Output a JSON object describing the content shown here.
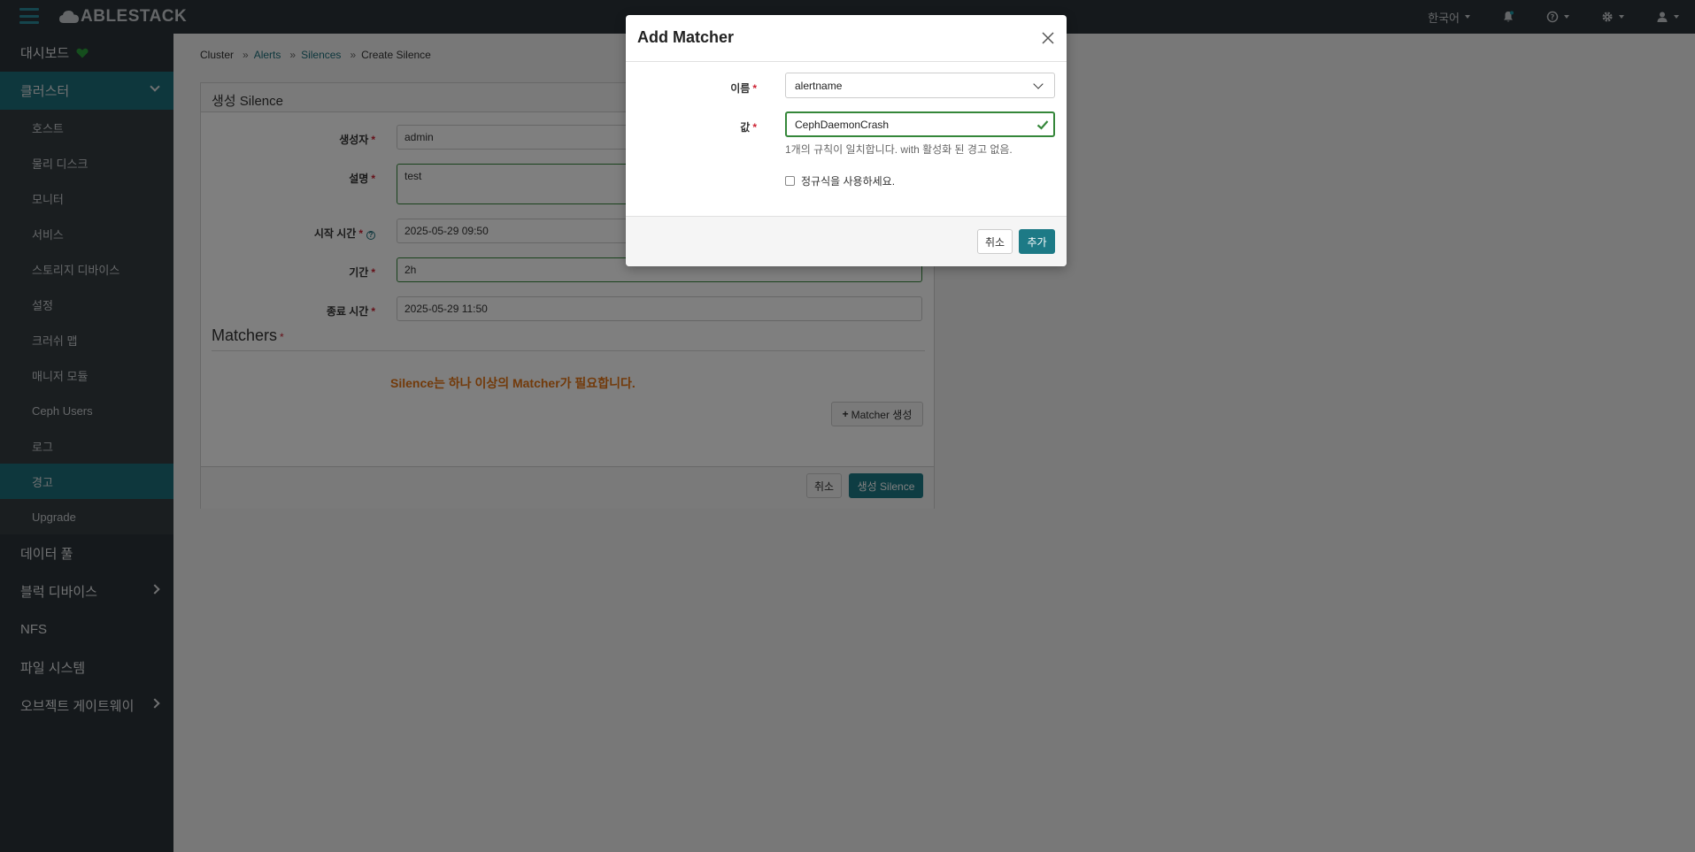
{
  "navbar": {
    "brand": "ABLESTACK",
    "language": "한국어"
  },
  "sidebar": {
    "dashboard": "대시보드",
    "cluster": "클러스터",
    "cluster_items": [
      "호스트",
      "물리 디스크",
      "모니터",
      "서비스",
      "스토리지 디바이스",
      "설정",
      "크러쉬 맵",
      "매니저 모듈",
      "Ceph Users",
      "로그",
      "경고",
      "Upgrade"
    ],
    "pools": "데이터 풀",
    "block": "블럭 디바이스",
    "nfs": "NFS",
    "filesystems": "파일 시스템",
    "object_gateway": "오브젝트 게이트웨이"
  },
  "breadcrumb": {
    "cluster": "Cluster",
    "alerts": "Alerts",
    "silences": "Silences",
    "current": "Create Silence"
  },
  "form": {
    "title": "생성 Silence",
    "creator_label": "생성자",
    "creator_value": "admin",
    "comment_label": "설명",
    "comment_value": "test",
    "start_label": "시작 시간",
    "start_value": "2025-05-29 09:50",
    "duration_label": "기간",
    "duration_value": "2h",
    "end_label": "종료 시간",
    "end_value": "2025-05-29 11:50",
    "matchers_title": "Matchers",
    "matchers_warning": "Silence는 하나 이상의 Matcher가 필요합니다.",
    "add_matcher_label": "Matcher 생성",
    "cancel_label": "취소",
    "submit_label": "생성 Silence"
  },
  "modal": {
    "title": "Add Matcher",
    "name_label": "이름",
    "name_value": "alertname",
    "value_label": "값",
    "value_value": "CephDaemonCrash",
    "hint": "1개의 규칙이 일치합니다. with 활성화 된 경고 없음.",
    "regex_label": "정규식을 사용하세요.",
    "cancel_label": "취소",
    "add_label": "추가"
  },
  "colors": {
    "accent": "#1d7a86",
    "warning": "#e47415",
    "valid": "#35873a"
  }
}
